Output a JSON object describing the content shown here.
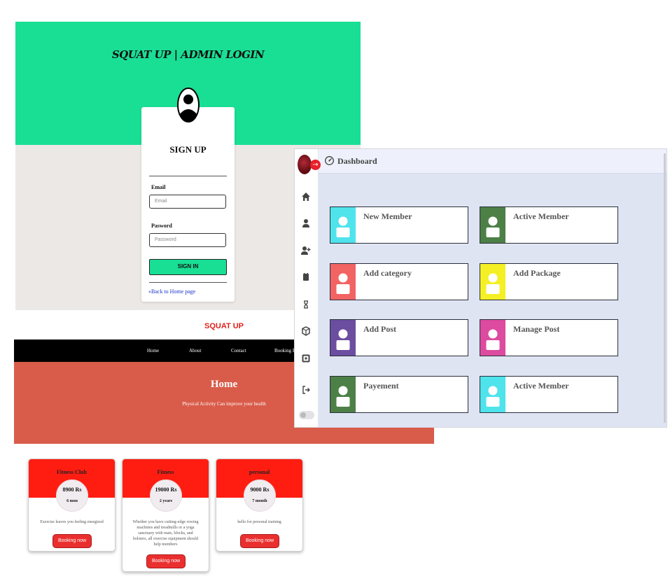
{
  "login": {
    "title": "SQUAT UP | ADMIN LOGIN",
    "card_title": "SIGN UP",
    "email_label": "Email",
    "email_placeholder": "Email",
    "password_label": "Pasword",
    "password_placeholder": "Password",
    "signin_label": "SIGN IN",
    "back_link": "Back to Home page",
    "accent": "#19df95"
  },
  "site": {
    "brand": "SQUAT UP",
    "nav": [
      "Home",
      "About",
      "Contact",
      "Booking Pa"
    ],
    "hero_title": "Home",
    "hero_subtitle": "Physical Activity Can improve your health",
    "hero_color": "#d95c4a",
    "packages": [
      {
        "name": "Fitness Club",
        "price": "8900 Rs",
        "duration": "6 mon",
        "description": "Exercise leaves you feeling energized",
        "button": "Booking now"
      },
      {
        "name": "Fitness",
        "price": "19000 Rs",
        "duration": "2 years",
        "description": "Whether you have cutting-edge rowing machines and treadmills or a yoga sanctuary with mats, blocks, and bolsters, all exercise equipment should help members",
        "button": "Booking now"
      },
      {
        "name": "personal",
        "price": "9000 Rs",
        "duration": "7 month",
        "description": "hello for personal training",
        "button": "Booking now"
      }
    ]
  },
  "dashboard": {
    "title": "Dashboard",
    "sidebar_icons": [
      "home-icon",
      "user-icon",
      "add-user-icon",
      "calendar-icon",
      "hourglass-icon",
      "box-icon",
      "square-icon",
      "logout-icon"
    ],
    "tiles": [
      {
        "label": "New Member",
        "color": "#4fe3ec"
      },
      {
        "label": "Active Member",
        "color": "#4d8047"
      },
      {
        "label": "Add category",
        "color": "#f26363"
      },
      {
        "label": "Add Package",
        "color": "#f4f025"
      },
      {
        "label": "Add Post",
        "color": "#6c4ea0"
      },
      {
        "label": "Manage Post",
        "color": "#dc4b9f"
      },
      {
        "label": "Payement",
        "color": "#4d8047"
      },
      {
        "label": "Active Member",
        "color": "#4fe3ec"
      }
    ]
  }
}
